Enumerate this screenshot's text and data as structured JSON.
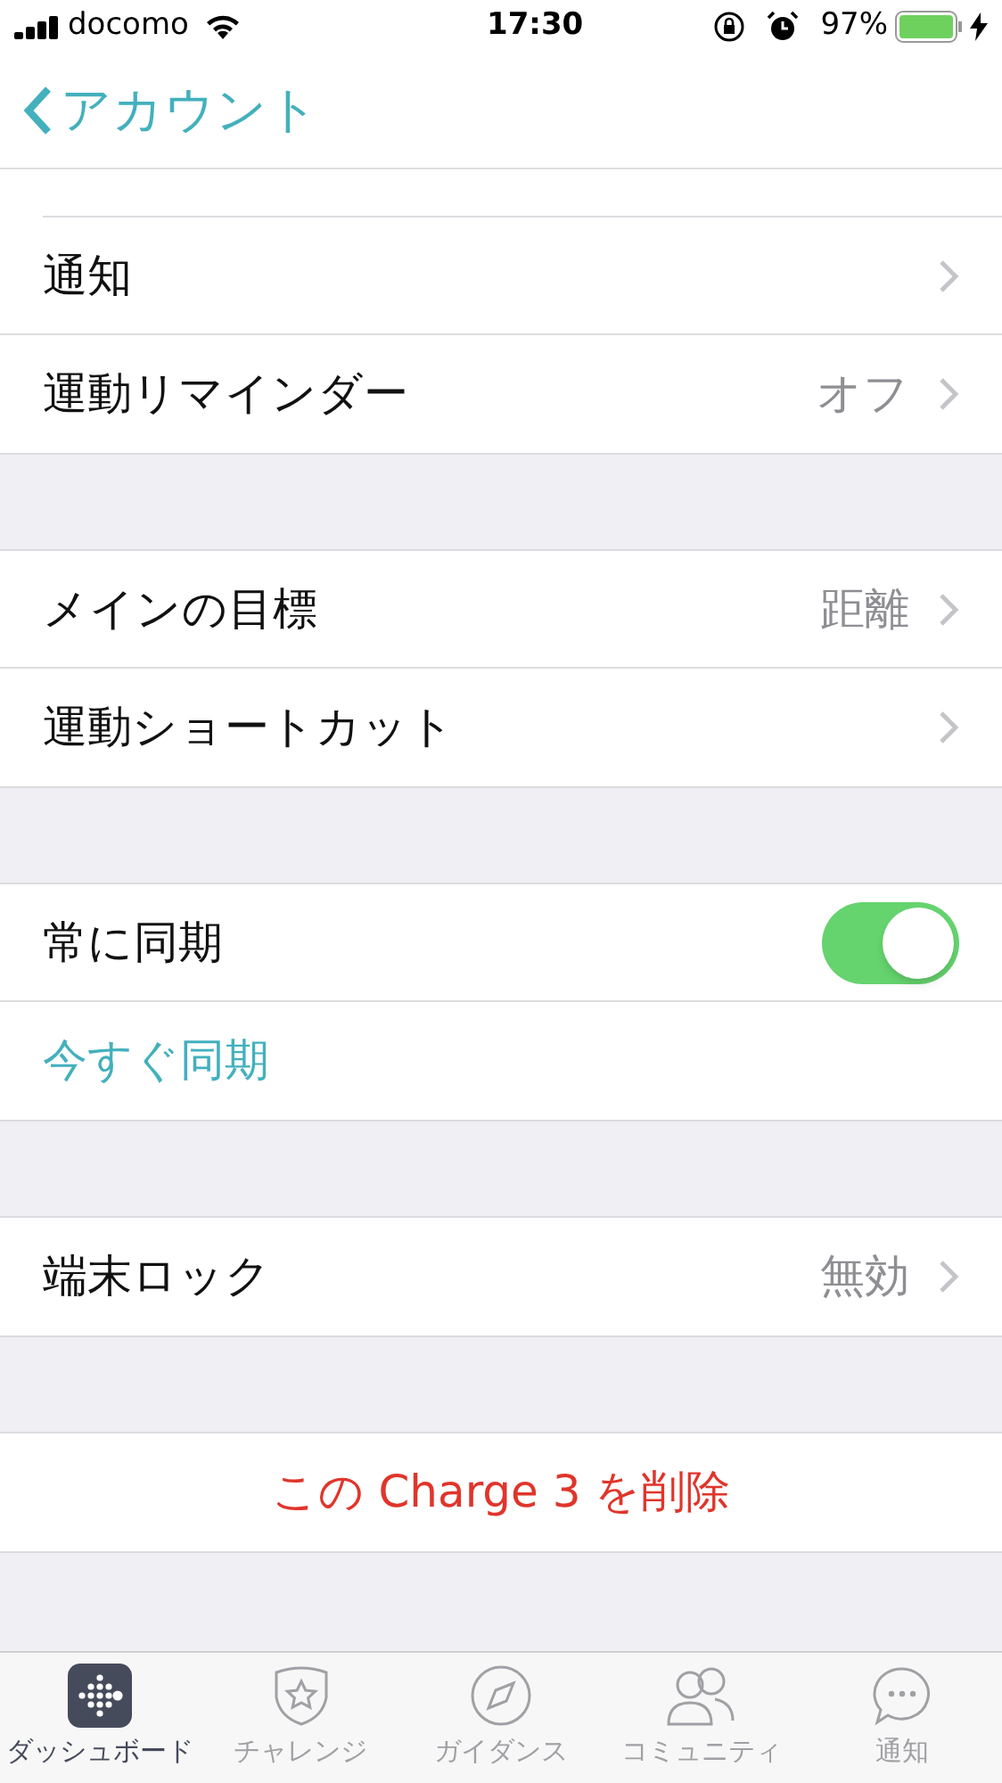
{
  "status_bar": {
    "carrier": "docomo",
    "time": "17:30",
    "battery": "97%"
  },
  "nav": {
    "back_label": "アカウント"
  },
  "sections": [
    {
      "rows": [
        {
          "kind": "nav",
          "label": "通知"
        },
        {
          "kind": "nav",
          "label": "運動リマインダー",
          "value": "オフ"
        }
      ]
    },
    {
      "rows": [
        {
          "kind": "nav",
          "label": "メインの目標",
          "value": "距離"
        },
        {
          "kind": "nav",
          "label": "運動ショートカット"
        }
      ]
    },
    {
      "rows": [
        {
          "kind": "toggle",
          "label": "常に同期",
          "on": true
        },
        {
          "kind": "action",
          "label": "今すぐ同期"
        }
      ]
    },
    {
      "rows": [
        {
          "kind": "nav",
          "label": "端末ロック",
          "value": "無効"
        }
      ]
    },
    {
      "rows": [
        {
          "kind": "destructive",
          "label": "この Charge 3 を削除"
        }
      ]
    }
  ],
  "tabs": [
    {
      "label": "ダッシュボード",
      "selected": true
    },
    {
      "label": "チャレンジ",
      "selected": false
    },
    {
      "label": "ガイダンス",
      "selected": false
    },
    {
      "label": "コミュニティ",
      "selected": false
    },
    {
      "label": "通知",
      "selected": false
    }
  ]
}
